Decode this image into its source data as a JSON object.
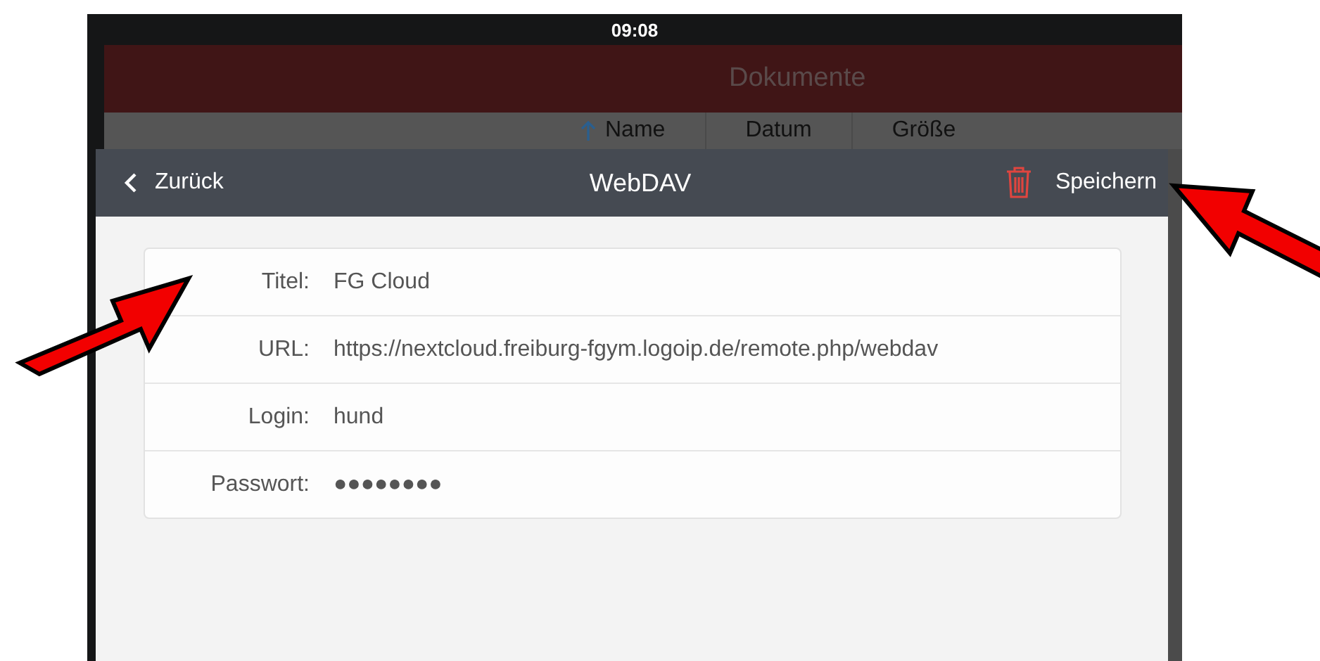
{
  "status_bar": {
    "time": "09:08"
  },
  "background_app": {
    "title": "Dokumente",
    "columns": [
      {
        "label": "Name",
        "sorted": true
      },
      {
        "label": "Datum",
        "sorted": false
      },
      {
        "label": "Größe",
        "sorted": false
      }
    ]
  },
  "dialog": {
    "back": "Zurück",
    "title": "WebDAV",
    "save": "Speichern",
    "fields": [
      {
        "label": "Titel:",
        "value": "FG Cloud"
      },
      {
        "label": "URL:",
        "value": "https://nextcloud.freiburg-fgym.logoip.de/remote.php/webdav"
      },
      {
        "label": "Login:",
        "value": "hund"
      },
      {
        "label": "Passwort:",
        "value": "●●●●●●●●"
      }
    ]
  }
}
